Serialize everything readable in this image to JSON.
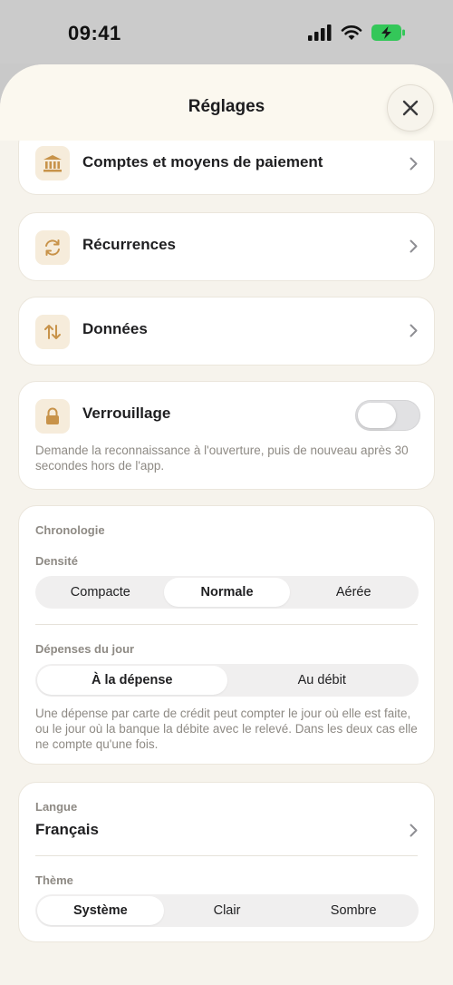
{
  "status_bar": {
    "time": "09:41",
    "icons": [
      "signal-icon",
      "wifi-icon",
      "battery-charging-icon"
    ]
  },
  "header": {
    "title": "Réglages",
    "close_icon": "close-icon"
  },
  "rows": {
    "accounts": {
      "label": "Comptes et moyens de paiement",
      "icon": "bank-icon"
    },
    "recurrences": {
      "label": "Récurrences",
      "icon": "refresh-icon"
    },
    "data": {
      "label": "Données",
      "icon": "arrows-up-down-icon"
    }
  },
  "lock": {
    "label": "Verrouillage",
    "icon": "lock-icon",
    "enabled": false,
    "description": "Demande la reconnaissance à l'ouverture, puis de nouveau après 30 secondes hors de l'app."
  },
  "timeline": {
    "section_title": "Chronologie",
    "density": {
      "label": "Densité",
      "options": [
        "Compacte",
        "Normale",
        "Aérée"
      ],
      "selected": "Normale"
    },
    "daily_spending": {
      "label": "Dépenses du jour",
      "options": [
        "À la dépense",
        "Au débit"
      ],
      "selected": "À la dépense",
      "description": "Une dépense par carte de crédit peut compter le jour où elle est faite, ou le jour où la banque la débite avec le relevé. Dans les deux cas elle ne compte qu'une fois."
    }
  },
  "language": {
    "label": "Langue",
    "value": "Français"
  },
  "theme": {
    "label": "Thème",
    "options": [
      "Système",
      "Clair",
      "Sombre"
    ],
    "selected": "Système"
  },
  "colors": {
    "accent": "#c8934a",
    "icon_bg": "#f6ecdb",
    "sheet_bg": "#f6f3ec"
  }
}
